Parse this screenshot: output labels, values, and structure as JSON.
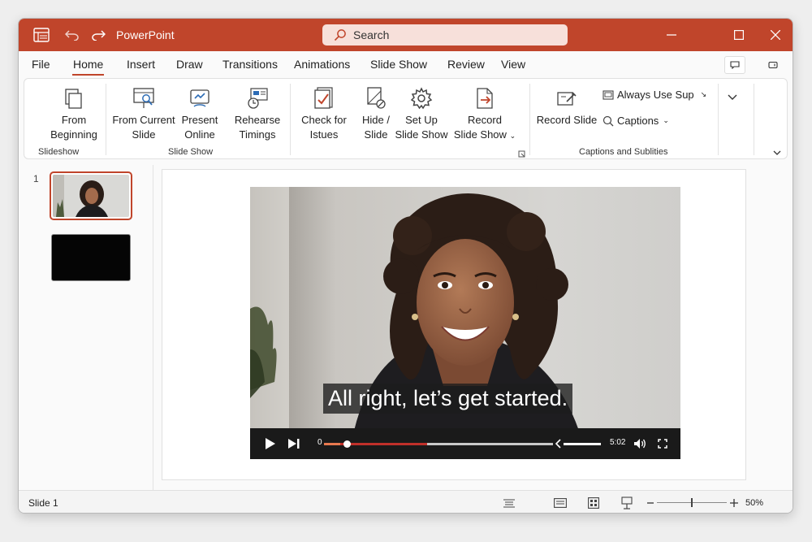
{
  "app": {
    "title": "PowerPoint"
  },
  "search": {
    "label": "Search"
  },
  "menu": {
    "tabs": [
      {
        "label": "File"
      },
      {
        "label": "Home",
        "active": true
      },
      {
        "label": "Insert"
      },
      {
        "label": "Draw"
      },
      {
        "label": "Transitions"
      },
      {
        "label": "Animations"
      },
      {
        "label": "Slide Show"
      },
      {
        "label": "Review"
      },
      {
        "label": "View"
      }
    ]
  },
  "ribbon": {
    "from_beginning": {
      "line1": "From",
      "line2": "Beginning"
    },
    "from_current": {
      "line1": "From Current",
      "line2": "Slide"
    },
    "present_online": {
      "line1": "Present",
      "line2": "Online"
    },
    "rehearse": {
      "line1": "Rehearse",
      "line2": "Timings"
    },
    "check_issues": {
      "line1": "Check for",
      "line2": "Istues"
    },
    "hide_slide": {
      "line1": "Hide /",
      "line2": "Slide"
    },
    "setup": {
      "line1": "Set Up",
      "line2": "Slide Show"
    },
    "record_show": {
      "line1": "Record",
      "line2": "Slide Show"
    },
    "record_slide": "Record Slide",
    "always_use": "Always Use Sup",
    "captions": "Captions",
    "groups": {
      "slideshow": "Slideshow",
      "slide_show": "Slide Show",
      "captions_subtitles": "Captions and Sublities"
    }
  },
  "thumbnails": {
    "first_number": "1"
  },
  "video": {
    "caption": "All right, let’s get started.",
    "time_start": "0",
    "time_end": "5:02",
    "progress_fraction": 0.45,
    "buffered_fraction": 0.07,
    "thumb_fraction": 0.1,
    "volume_fraction": 1.0
  },
  "status": {
    "slide_label": "Slide 1",
    "zoom": "50%"
  },
  "colors": {
    "accent": "#c0452b"
  }
}
